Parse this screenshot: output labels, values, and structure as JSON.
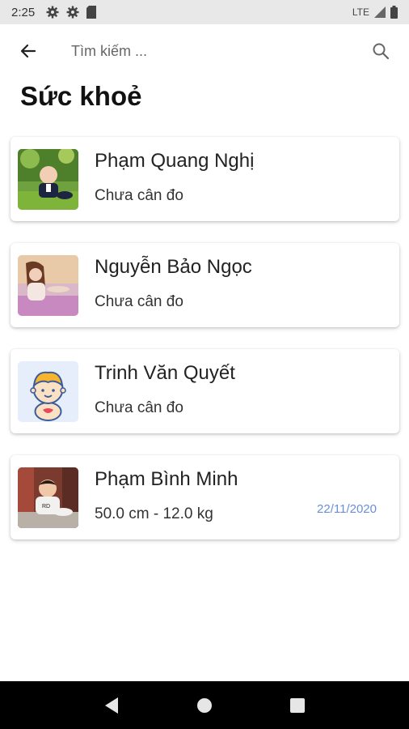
{
  "status_bar": {
    "time": "2:25",
    "network": "LTE"
  },
  "search": {
    "placeholder": "Tìm kiếm ..."
  },
  "page": {
    "title": "Sức khoẻ"
  },
  "people": [
    {
      "name": "Phạm Quang Nghị",
      "status": "Chưa cân đo",
      "date": "",
      "avatar": "baby-photo-icon"
    },
    {
      "name": "Nguyễn Bảo Ngọc",
      "status": "Chưa cân đo",
      "date": "",
      "avatar": "girl-photo-icon"
    },
    {
      "name": "Trinh Văn Quyết",
      "status": "Chưa cân đo",
      "date": "",
      "avatar": "baby-cartoon-icon"
    },
    {
      "name": "Phạm Bình Minh",
      "status": "50.0 cm - 12.0 kg",
      "date": "22/11/2020",
      "avatar": "toddler-photo-icon"
    }
  ],
  "colors": {
    "accent_date": "#6a8ed9",
    "nav_bg": "#000000",
    "status_bg": "#e8e8e8"
  }
}
